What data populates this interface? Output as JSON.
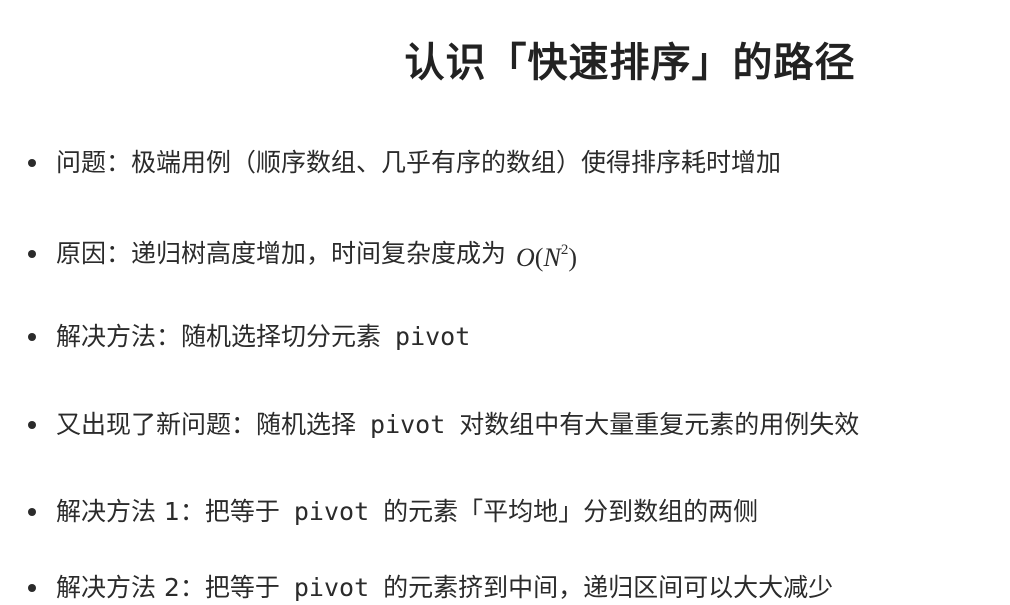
{
  "slide": {
    "title": "认识「快速排序」的路径"
  },
  "bullets": [
    {
      "text": "问题：极端用例（顺序数组、几乎有序的数组）使得排序耗时增加"
    },
    {
      "text": "原因：递归树高度增加，时间复杂度成为",
      "math": {
        "o": "O",
        "lp": "(",
        "n": "N",
        "exp": "2",
        "rp": ")"
      }
    },
    {
      "text": "解决方法：随机选择切分元素",
      "code": "pivot"
    },
    {
      "pre": "又出现了新问题：随机选择",
      "code": "pivot",
      "post": "对数组中有大量重复元素的用例失效"
    },
    {
      "pre": "解决方法 1：把等于",
      "code": "pivot",
      "post": "的元素「平均地」分到数组的两侧"
    },
    {
      "pre": "解决方法 2：把等于",
      "code": "pivot",
      "post": "的元素挤到中间，递归区间可以大大减少"
    }
  ]
}
